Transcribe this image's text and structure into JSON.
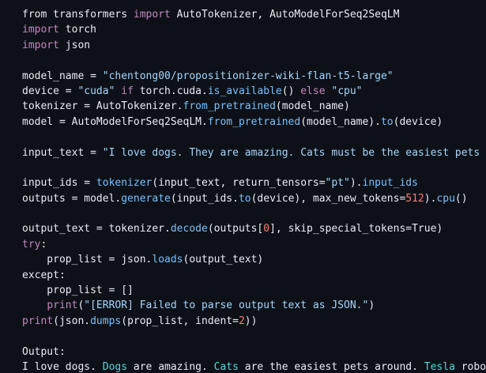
{
  "colors": {
    "background": "#0d1117",
    "text": "#e6edf3",
    "keyword": "#c586c0",
    "string": "#a5d6ff",
    "function": "#9cdcfe",
    "call": "#79c0ff",
    "number": "#ff7b72",
    "output_highlight": "#56d4dd"
  },
  "code_lines": [
    [
      {
        "t": "from transformers ",
        "c": "plain"
      },
      {
        "t": "import",
        "c": "kw"
      },
      {
        "t": " AutoTokenizer, AutoModelForSeq2SeqLM",
        "c": "plain"
      }
    ],
    [
      {
        "t": "import",
        "c": "kw"
      },
      {
        "t": " torch",
        "c": "plain"
      }
    ],
    [
      {
        "t": "import",
        "c": "kw"
      },
      {
        "t": " json",
        "c": "plain"
      }
    ],
    [],
    [
      {
        "t": "model_name = ",
        "c": "plain"
      },
      {
        "t": "\"chentong00/propositionizer-wiki-flan-t5-large\"",
        "c": "str"
      }
    ],
    [
      {
        "t": "device = ",
        "c": "plain"
      },
      {
        "t": "\"cuda\"",
        "c": "str"
      },
      {
        "t": " ",
        "c": "plain"
      },
      {
        "t": "if",
        "c": "kw"
      },
      {
        "t": " torch.cuda.",
        "c": "plain"
      },
      {
        "t": "is_available",
        "c": "call"
      },
      {
        "t": "() ",
        "c": "plain"
      },
      {
        "t": "else",
        "c": "kw"
      },
      {
        "t": " ",
        "c": "plain"
      },
      {
        "t": "\"cpu\"",
        "c": "str"
      }
    ],
    [
      {
        "t": "tokenizer = AutoTokenizer.",
        "c": "plain"
      },
      {
        "t": "from_pretrained",
        "c": "call"
      },
      {
        "t": "(model_name)",
        "c": "plain"
      }
    ],
    [
      {
        "t": "model = AutoModelForSeq2SeqLM.",
        "c": "plain"
      },
      {
        "t": "from_pretrained",
        "c": "call"
      },
      {
        "t": "(model_name).",
        "c": "plain"
      },
      {
        "t": "to",
        "c": "call"
      },
      {
        "t": "(device)",
        "c": "plain"
      }
    ],
    [],
    [
      {
        "t": "input_text = ",
        "c": "plain"
      },
      {
        "t": "\"I love dogs. They are amazing. Cats must be the easiest pets around. Tesla robots are advanced now with AI. They will take us to mars.\"",
        "c": "str"
      }
    ],
    [],
    [
      {
        "t": "input_ids = ",
        "c": "plain"
      },
      {
        "t": "tokenizer",
        "c": "call"
      },
      {
        "t": "(input_text, return_tensors=",
        "c": "plain"
      },
      {
        "t": "\"pt\"",
        "c": "str"
      },
      {
        "t": ").",
        "c": "plain"
      },
      {
        "t": "input_ids",
        "c": "call"
      }
    ],
    [
      {
        "t": "outputs = model.",
        "c": "plain"
      },
      {
        "t": "generate",
        "c": "call"
      },
      {
        "t": "(input_ids.",
        "c": "plain"
      },
      {
        "t": "to",
        "c": "call"
      },
      {
        "t": "(device), max_new_tokens=",
        "c": "plain"
      },
      {
        "t": "512",
        "c": "num"
      },
      {
        "t": ").",
        "c": "plain"
      },
      {
        "t": "cpu",
        "c": "call"
      },
      {
        "t": "()",
        "c": "plain"
      }
    ],
    [],
    [
      {
        "t": "output_text = tokenizer.",
        "c": "plain"
      },
      {
        "t": "decode",
        "c": "call"
      },
      {
        "t": "(outputs[",
        "c": "plain"
      },
      {
        "t": "0",
        "c": "num"
      },
      {
        "t": "], skip_special_tokens=True)",
        "c": "plain"
      }
    ],
    [
      {
        "t": "try",
        "c": "kw"
      },
      {
        "t": ":",
        "c": "plain"
      }
    ],
    [
      {
        "t": "    prop_list = json.",
        "c": "plain"
      },
      {
        "t": "loads",
        "c": "call"
      },
      {
        "t": "(output_text)",
        "c": "plain"
      }
    ],
    [
      {
        "t": "except",
        "c": "plain"
      },
      {
        "t": ":",
        "c": "plain"
      }
    ],
    [
      {
        "t": "    prop_list = []",
        "c": "plain"
      }
    ],
    [
      {
        "t": "    ",
        "c": "plain"
      },
      {
        "t": "print",
        "c": "kw"
      },
      {
        "t": "(",
        "c": "plain"
      },
      {
        "t": "\"[ERROR] Failed to parse output text as JSON.\"",
        "c": "str"
      },
      {
        "t": ")",
        "c": "plain"
      }
    ],
    [
      {
        "t": "print",
        "c": "kw"
      },
      {
        "t": "(json.",
        "c": "plain"
      },
      {
        "t": "dumps",
        "c": "call"
      },
      {
        "t": "(prop_list, indent=",
        "c": "plain"
      },
      {
        "t": "2",
        "c": "num"
      },
      {
        "t": "))",
        "c": "plain"
      }
    ],
    [],
    [
      {
        "t": "Output:",
        "c": "plain"
      }
    ],
    [
      {
        "t": "I love dogs. ",
        "c": "plain"
      },
      {
        "t": "Dogs",
        "c": "out"
      },
      {
        "t": " are amazing. ",
        "c": "plain"
      },
      {
        "t": "Cats",
        "c": "out"
      },
      {
        "t": " are the easiest pets around. ",
        "c": "plain"
      },
      {
        "t": "Tesla",
        "c": "out"
      },
      {
        "t": " robots are advanced now with AI.",
        "c": "plain"
      }
    ]
  ]
}
